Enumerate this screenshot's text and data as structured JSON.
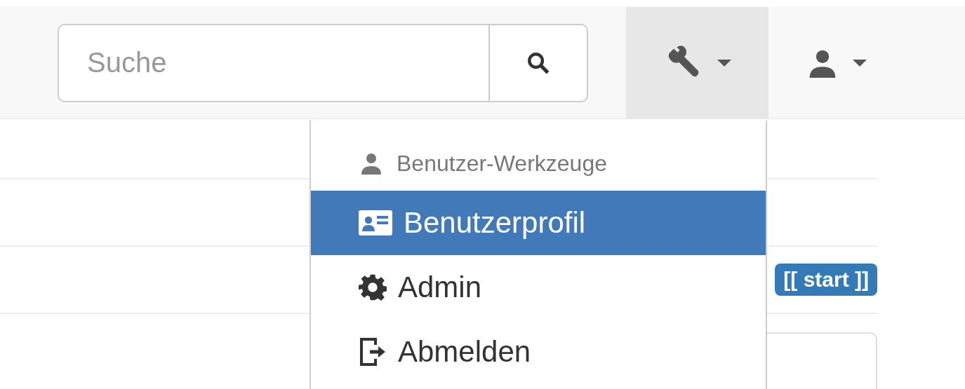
{
  "navbar": {
    "search": {
      "placeholder": "Suche"
    },
    "tools_menu": {
      "expanded": true
    },
    "user_menu": {
      "expanded": false
    }
  },
  "tools_dropdown": {
    "header": "Benutzer-Werkzeuge",
    "items": [
      {
        "kind": "profile",
        "label": "Benutzerprofil",
        "selected": true
      },
      {
        "kind": "admin",
        "label": "Admin",
        "selected": false
      },
      {
        "kind": "logout",
        "label": "Abmelden",
        "selected": false
      }
    ]
  },
  "page": {
    "badge": "[[ start ]]"
  }
}
